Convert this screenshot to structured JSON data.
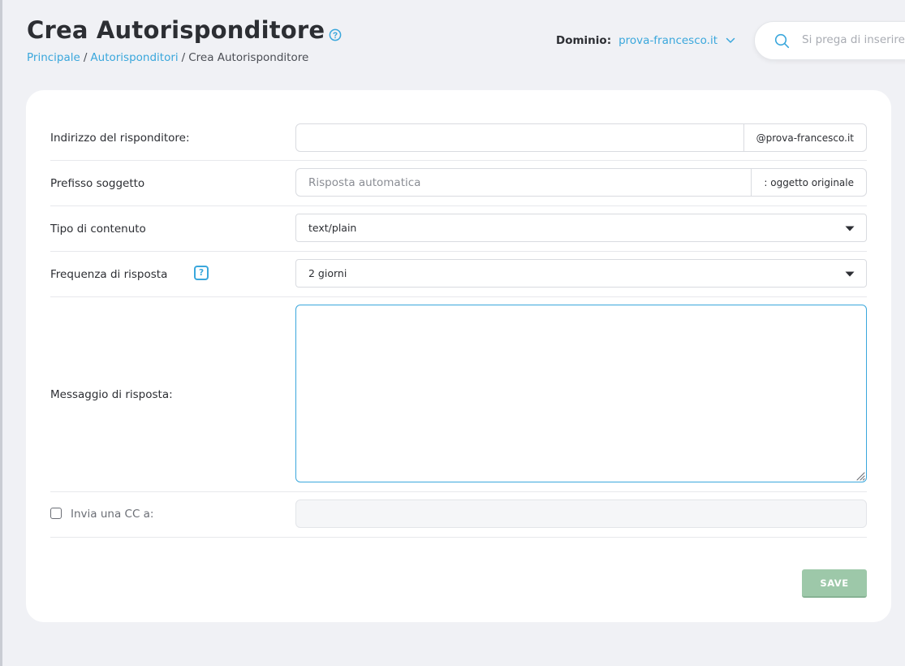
{
  "header": {
    "title": "Crea Autorisponditore",
    "breadcrumb": {
      "home": "Principale",
      "section": "Autorisponditori",
      "current": "Crea Autorisponditore",
      "separator": "/"
    },
    "domain": {
      "label": "Dominio:",
      "value": "prova-francesco.it"
    },
    "search": {
      "placeholder": "Si prega di inserire"
    }
  },
  "form": {
    "responder_address": {
      "label": "Indirizzo del risponditore:",
      "value": "",
      "suffix": "@prova-francesco.it"
    },
    "subject_prefix": {
      "label": "Prefisso soggetto",
      "placeholder": "Risposta automatica",
      "suffix": ": oggetto originale"
    },
    "content_type": {
      "label": "Tipo di contenuto",
      "selected": "text/plain"
    },
    "reply_frequency": {
      "label": "Frequenza di risposta",
      "help": "?",
      "selected": "2 giorni"
    },
    "reply_message": {
      "label": "Messaggio di risposta:",
      "value": ""
    },
    "send_cc": {
      "label": "Invia una CC a:",
      "checked": false,
      "value": ""
    },
    "save_label": "SAVE"
  },
  "colors": {
    "accent": "#3aa7dc",
    "background": "#f0f1f5",
    "save_button": "#9dc8a9"
  }
}
